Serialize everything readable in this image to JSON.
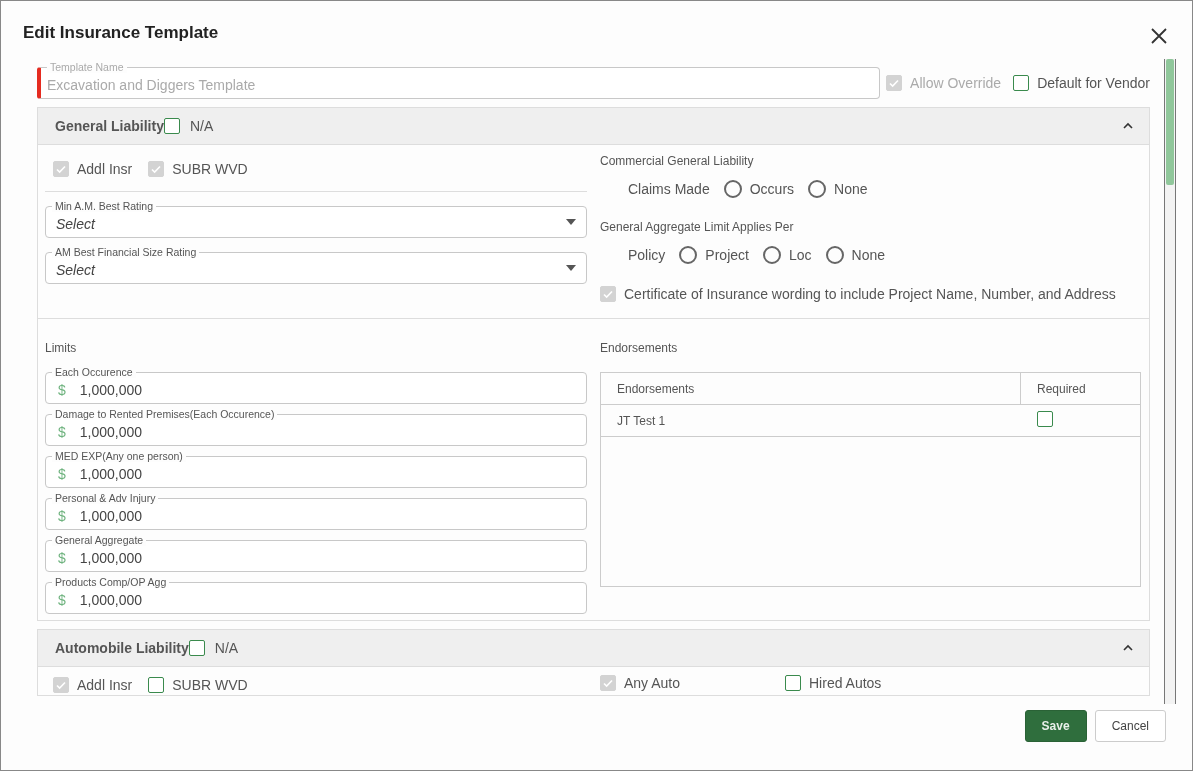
{
  "dialog": {
    "title": "Edit Insurance Template"
  },
  "template_name": {
    "label": "Template Name",
    "value": "Excavation and Diggers Template",
    "disabled": true
  },
  "allow_override": {
    "label": "Allow Override",
    "checked": true,
    "disabled": true
  },
  "default_for_vendor": {
    "label": "Default for Vendor",
    "checked": false
  },
  "sections": [
    {
      "kind": "general",
      "title": "General Liability",
      "na": {
        "label": "N/A",
        "checked": false
      },
      "expanded": true,
      "flags": [
        {
          "label": "Addl Insr",
          "checked": true,
          "disabled": true
        },
        {
          "label": "SUBR WVD",
          "checked": true,
          "disabled": true
        }
      ],
      "ratings": [
        {
          "label": "Min A.M. Best Rating",
          "placeholder": "Select"
        },
        {
          "label": "AM Best Financial Size Rating",
          "placeholder": "Select"
        }
      ],
      "radio_groups": [
        {
          "title": "Commercial General Liability",
          "lead": "Claims Made",
          "options": [
            {
              "label": "Occurs",
              "selected": false
            },
            {
              "label": "None",
              "selected": false
            }
          ]
        },
        {
          "title": "General Aggregate Limit Applies Per",
          "lead": "Policy",
          "options": [
            {
              "label": "Project",
              "selected": false
            },
            {
              "label": "Loc",
              "selected": false
            },
            {
              "label": "None",
              "selected": false
            }
          ]
        }
      ],
      "certificate": {
        "label": "Certificate of Insurance wording to include Project Name, Number, and Address",
        "checked": true,
        "disabled": true
      },
      "limits": {
        "title": "Limits",
        "fields": [
          {
            "label": "Each Occurence",
            "prefix": "$",
            "value": "1,000,000"
          },
          {
            "label": "Damage to Rented Premises(Each Occurence)",
            "prefix": "$",
            "value": "1,000,000"
          },
          {
            "label": "MED EXP(Any one person)",
            "prefix": "$",
            "value": "1,000,000"
          },
          {
            "label": "Personal & Adv Injury",
            "prefix": "$",
            "value": "1,000,000"
          },
          {
            "label": "General Aggregate",
            "prefix": "$",
            "value": "1,000,000"
          },
          {
            "label": "Products Comp/OP Agg",
            "prefix": "$",
            "value": "1,000,000"
          }
        ]
      },
      "endorsements": {
        "title": "Endorsements",
        "columns": [
          "Endorsements",
          "Required"
        ],
        "rows": [
          {
            "name": "JT Test 1",
            "required": false
          }
        ]
      }
    },
    {
      "kind": "auto",
      "title": "Automobile Liability",
      "na": {
        "label": "N/A",
        "checked": false
      },
      "expanded": true,
      "flags": [
        {
          "label": "Addl Insr",
          "checked": true,
          "disabled": true
        },
        {
          "label": "SUBR WVD",
          "checked": false,
          "disabled": false
        }
      ],
      "coverage": [
        {
          "label": "Any Auto",
          "checked": true,
          "disabled": true
        },
        {
          "label": "Hired Autos",
          "checked": false,
          "disabled": false
        }
      ]
    }
  ],
  "buttons": {
    "save": "Save",
    "cancel": "Cancel"
  }
}
